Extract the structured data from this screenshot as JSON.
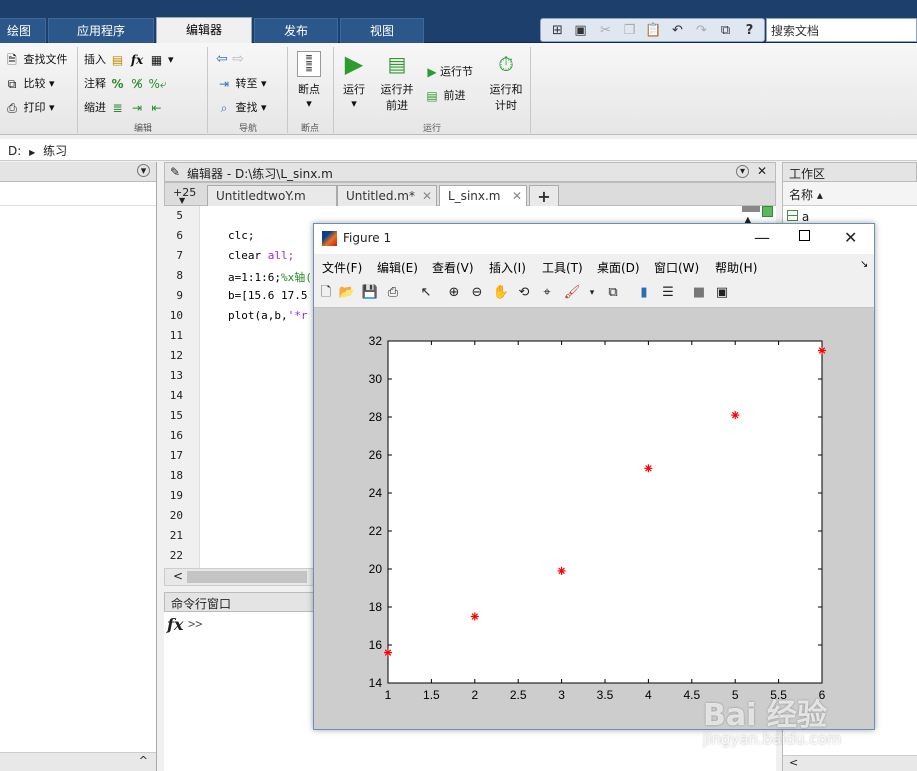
{
  "ribbon_tabs": [
    "绘图",
    "应用程序",
    "编辑器",
    "发布",
    "视图"
  ],
  "search": {
    "placeholder": "搜索文档"
  },
  "ribbon": {
    "find_files": "查找文件",
    "compare": "比较",
    "print": "打印",
    "insert": "插入",
    "comment": "注释",
    "indent": "缩进",
    "fx": "fx",
    "goto": "转至",
    "find": "查找",
    "breakpoints": "断点",
    "run": "运行",
    "run_advance_1": "运行并",
    "run_advance_2": "前进",
    "run_section": "运行节",
    "advance": "前进",
    "run_time_1": "运行和",
    "run_time_2": "计时",
    "group_edit": "编辑",
    "group_nav": "导航",
    "group_breakpoints": "断点",
    "group_run": "运行"
  },
  "address": {
    "drive": "D:",
    "folder": "练习"
  },
  "editor": {
    "title": "编辑器 - D:\\练习\\L_sinx.m",
    "tab_badge": "+25",
    "tabs": [
      "UntitledtwoY.m",
      "Untitled.m*",
      "L_sinx.m"
    ],
    "add_tab": "+",
    "line_numbers": [
      "5",
      "6",
      "7",
      "8",
      "9",
      "10",
      "11",
      "12",
      "13",
      "14",
      "15",
      "16",
      "17",
      "18",
      "19",
      "20",
      "21",
      "22"
    ],
    "code": {
      "l6": "clc;",
      "l7_a": "clear ",
      "l7_b": "all;",
      "l8_a": "a=1:1:6;",
      "l8_b": "%x轴(",
      "l9": "b=[15.6 17.5",
      "l10_a": "plot(a,b,",
      "l10_b": "'*r"
    }
  },
  "command_window": {
    "title": "命令行窗口",
    "prompt": ">>"
  },
  "workspace": {
    "title": "工作区",
    "column": "名称 ▴",
    "var": "a"
  },
  "figure": {
    "title": "Figure 1",
    "menu": [
      "文件(F)",
      "编辑(E)",
      "查看(V)",
      "插入(I)",
      "工具(T)",
      "桌面(D)",
      "窗口(W)",
      "帮助(H)"
    ]
  },
  "chart_data": {
    "type": "scatter",
    "x": [
      1,
      2,
      3,
      4,
      5,
      6
    ],
    "y": [
      15.6,
      17.5,
      19.9,
      25.3,
      28.1,
      31.5
    ],
    "marker": "*",
    "color": "#ff0000",
    "xlim": [
      1,
      6
    ],
    "ylim": [
      14,
      32
    ],
    "xticks": [
      "1",
      "1.5",
      "2",
      "2.5",
      "3",
      "3.5",
      "4",
      "4.5",
      "5",
      "5.5",
      "6"
    ],
    "yticks": [
      "14",
      "16",
      "18",
      "20",
      "22",
      "24",
      "26",
      "28",
      "30",
      "32"
    ]
  },
  "watermark": {
    "brand": "Bai 经验",
    "url": "jingyan.baidu.com"
  }
}
